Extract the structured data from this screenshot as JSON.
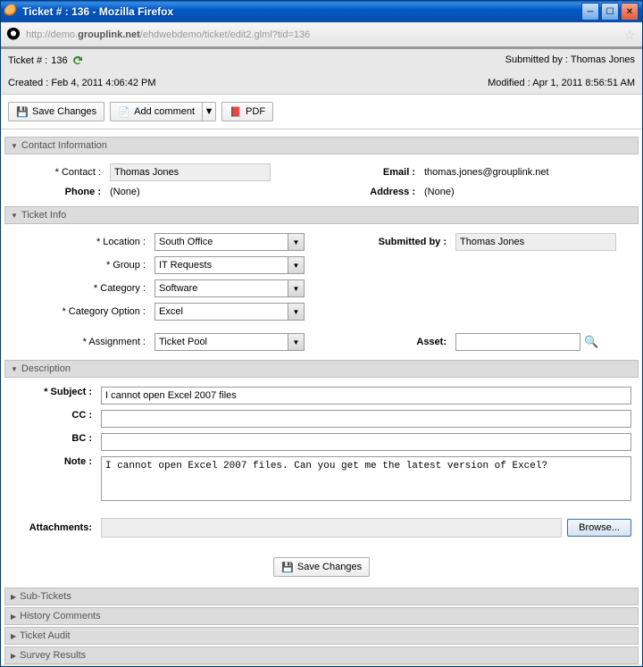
{
  "window": {
    "title": "Ticket # : 136 - Mozilla Firefox"
  },
  "addressbar": {
    "prefix": "http://demo.",
    "host": "grouplink.net",
    "path": "/ehdwebdemo/ticket/edit2.glml?tid=136"
  },
  "meta": {
    "ticket_label": "Ticket # :",
    "ticket_num": "136",
    "submitted_by_label": "Submitted by :",
    "submitted_by": "Thomas Jones",
    "created_label": "Created :",
    "created": "Feb 4, 2011 4:06:42 PM",
    "modified_label": "Modified :",
    "modified": "Apr 1, 2011 8:56:51 AM"
  },
  "toolbar": {
    "save": "Save Changes",
    "add_comment": "Add comment",
    "pdf": "PDF"
  },
  "sections": {
    "contact": "Contact Information",
    "ticket_info": "Ticket Info",
    "description": "Description",
    "sub_tickets": "Sub-Tickets",
    "history": "History Comments",
    "audit": "Ticket Audit",
    "survey": "Survey Results"
  },
  "contact": {
    "contact_label": "Contact :",
    "contact_value": "Thomas Jones",
    "email_label": "Email :",
    "email_value": "thomas.jones@grouplink.net",
    "phone_label": "Phone :",
    "phone_value": "(None)",
    "address_label": "Address :",
    "address_value": "(None)"
  },
  "ticket": {
    "location_label": "Location :",
    "location_value": "South Office",
    "group_label": "Group :",
    "group_value": "IT Requests",
    "category_label": "Category :",
    "category_value": "Software",
    "catopt_label": "Category Option :",
    "catopt_value": "Excel",
    "assignment_label": "Assignment :",
    "assignment_value": "Ticket Pool",
    "submitted_label": "Submitted by :",
    "submitted_value": "Thomas Jones",
    "asset_label": "Asset:"
  },
  "desc": {
    "subject_label": "Subject :",
    "subject_value": "I cannot open Excel 2007 files",
    "cc_label": "CC :",
    "bc_label": "BC :",
    "note_label": "Note :",
    "note_value": "I cannot open Excel 2007 files. Can you get me the latest version of Excel?",
    "attach_label": "Attachments:",
    "browse": "Browse...",
    "save_bottom": "Save Changes"
  }
}
